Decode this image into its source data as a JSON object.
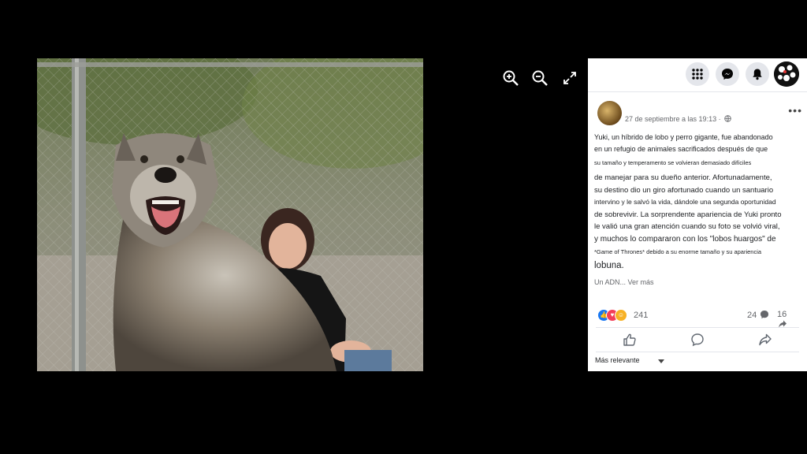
{
  "viewer": {
    "photo_alt": "Wolf-dog hybrid with a smiling woman behind a chain-link fence",
    "tools": {
      "zoom_in": "zoom-in-icon",
      "zoom_out": "zoom-out-icon",
      "fullscreen": "fullscreen-icon"
    }
  },
  "topbar": {
    "icons": [
      "apps-grid-icon",
      "messenger-icon",
      "bell-icon",
      "profile-avatar"
    ]
  },
  "post": {
    "timestamp": "27 de septiembre a las 19:13 ·",
    "audience_icon": "globe-icon",
    "body_lines": [
      "Yuki, un híbrido de lobo y perro gigante, fue abandonado",
      "en un refugio de animales sacrificados después de que",
      "su tamaño y temperamento se volvieran demasiado difíciles",
      "de manejar para su dueño anterior. Afortunadamente,",
      "su destino dio un giro afortunado cuando un santuario",
      "intervino y le salvó la vida, dándole una segunda oportunidad",
      "de sobrevivir. La sorprendente apariencia de Yuki pronto",
      "le valió una gran atención cuando su foto se volvió viral,",
      "y muchos lo compararon con los \"lobos huargos\" de",
      "*Game of Thrones* debido a su enorme tamaño y su apariencia",
      "lobuna."
    ],
    "see_more": "Un ADN... Ver más",
    "reactions": {
      "icons": [
        "like",
        "love",
        "care"
      ],
      "count": "241"
    },
    "comments_count": "24",
    "shares_count": "16",
    "actions": {
      "like": "like-icon",
      "comment": "comment-icon",
      "share": "share-icon"
    },
    "sort_label": "Más relevante"
  },
  "colors": {
    "like": "#1877f2",
    "love": "#f33e58",
    "care": "#f7b125",
    "panel_bg": "#ffffff",
    "viewer_bg": "#000000"
  }
}
